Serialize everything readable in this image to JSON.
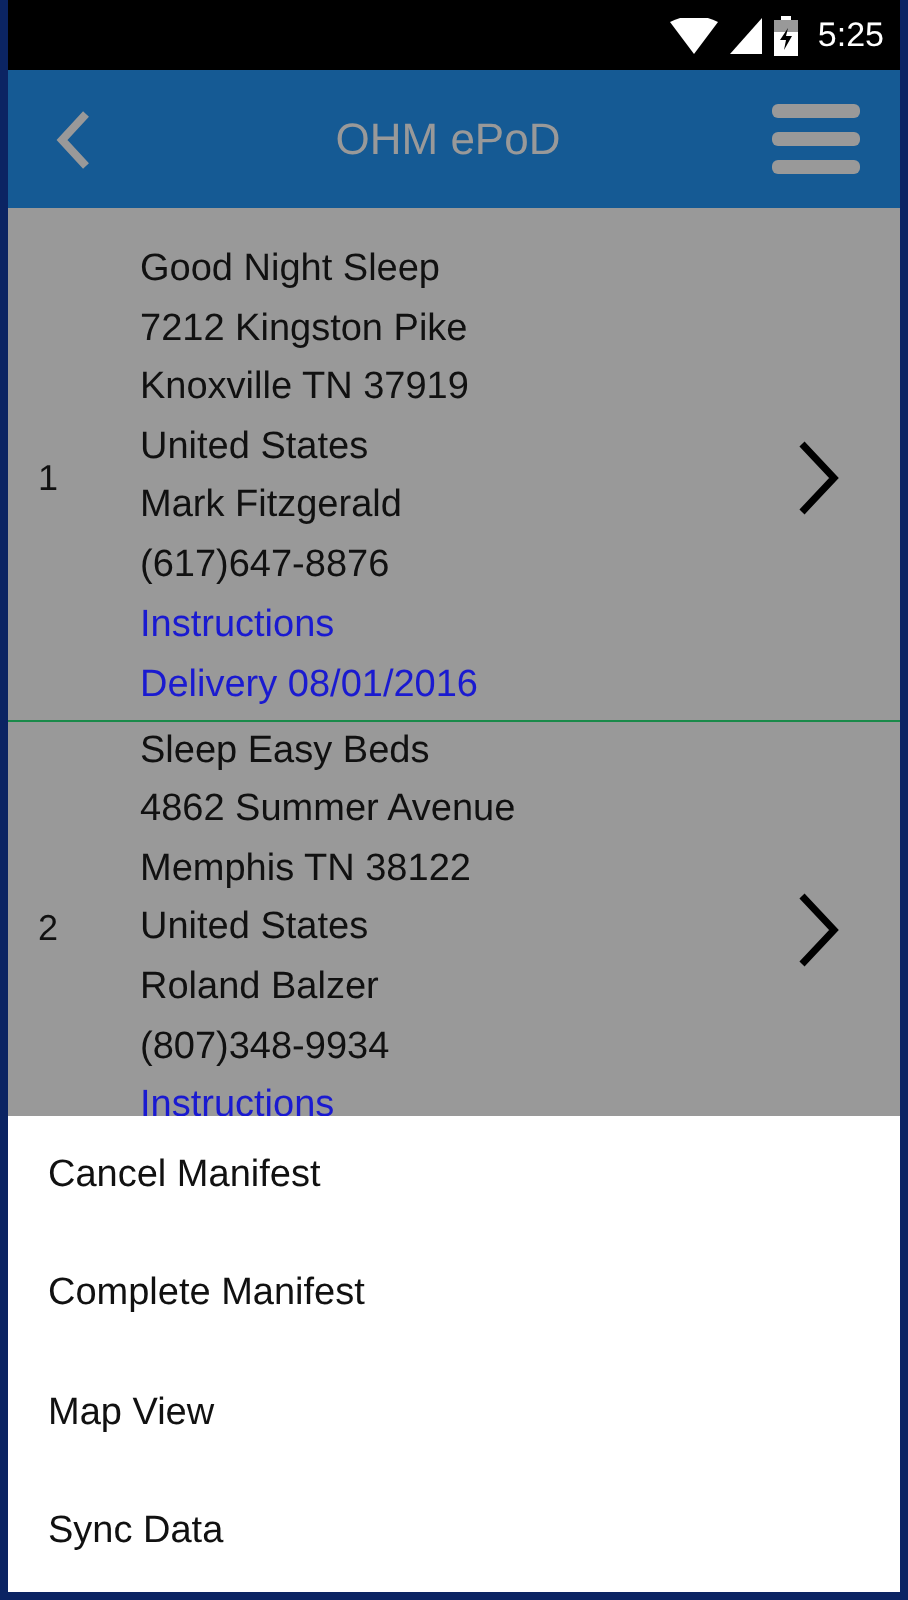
{
  "status_bar": {
    "time": "5:25"
  },
  "app_bar": {
    "title": "OHM ePoD"
  },
  "stops": [
    {
      "number": "1",
      "lines": [
        "Good Night Sleep",
        "7212 Kingston Pike",
        "Knoxville TN 37919",
        "United States",
        "Mark Fitzgerald",
        "(617)647-8876"
      ],
      "links": [
        "Instructions",
        "Delivery 08/01/2016"
      ]
    },
    {
      "number": "2",
      "lines": [
        "Sleep Easy Beds",
        "4862 Summer Avenue",
        "Memphis TN 38122",
        "United States",
        "Roland Balzer",
        "(807)348-9934"
      ],
      "links": [
        "Instructions"
      ]
    }
  ],
  "menu": [
    "Cancel Manifest",
    "Complete Manifest",
    "Map View",
    "Sync Data"
  ]
}
